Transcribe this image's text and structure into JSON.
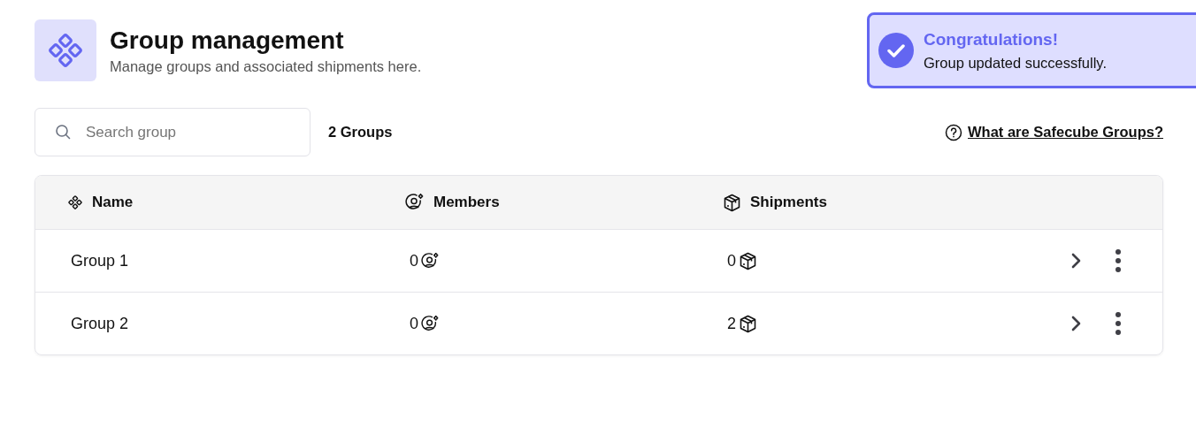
{
  "header": {
    "title": "Group management",
    "subtitle": "Manage groups and associated shipments here."
  },
  "toast": {
    "title": "Congratulations!",
    "message": "Group updated successfully."
  },
  "search": {
    "placeholder": "Search group"
  },
  "count": "2 Groups",
  "help_link": "What are Safecube Groups?",
  "table": {
    "columns": [
      "Name",
      "Members",
      "Shipments"
    ],
    "rows": [
      {
        "name": "Group 1",
        "members": "0",
        "shipments": "0"
      },
      {
        "name": "Group 2",
        "members": "0",
        "shipments": "2"
      }
    ]
  }
}
